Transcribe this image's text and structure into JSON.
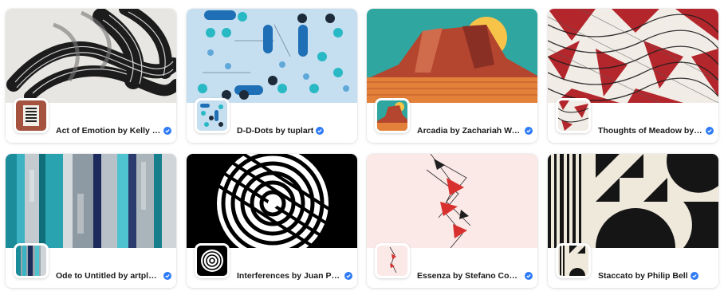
{
  "cards": [
    {
      "title": "Act of Emotion by Kelly Milligan",
      "verified_icon": "verified-badge-icon"
    },
    {
      "title": "D-D-Dots by tuplart",
      "verified_icon": "verified-badge-icon"
    },
    {
      "title": "Arcadia by Zachariah Watson",
      "verified_icon": "verified-badge-icon"
    },
    {
      "title": "Thoughts of Meadow by Kim Asendorf",
      "verified_icon": "verified-badge-icon"
    },
    {
      "title": "Ode to Untitled by artplusbrad",
      "verified_icon": "verified-badge-icon"
    },
    {
      "title": "Interferences by Juan Pedro Vallejo",
      "verified_icon": "verified-badge-icon"
    },
    {
      "title": "Essenza by Stefano Contiero",
      "verified_icon": "verified-badge-icon"
    },
    {
      "title": "Staccato by Philip Bell",
      "verified_icon": "verified-badge-icon"
    }
  ],
  "colors": {
    "verified_blue": "#2f7bf6",
    "title_text": "#1a1a1a"
  }
}
